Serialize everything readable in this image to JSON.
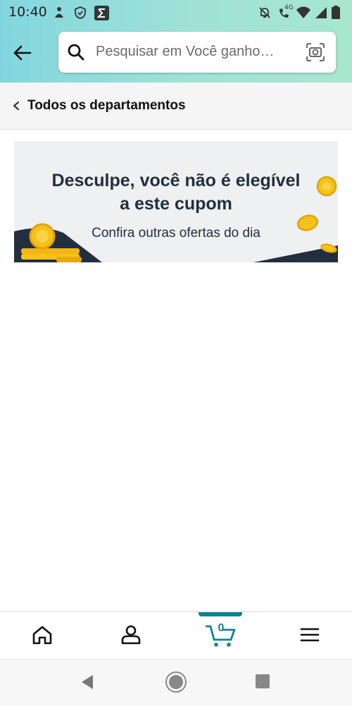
{
  "status_bar": {
    "time": "10:40",
    "left_icons": [
      "person-badge-icon",
      "shield-icon",
      "sigma-app-icon"
    ],
    "right_icons": [
      "notifications-off-icon",
      "call-4g-icon",
      "wifi-icon",
      "signal-icon",
      "battery-icon"
    ],
    "network_label": "4G"
  },
  "search": {
    "placeholder": "Pesquisar em Você ganho…"
  },
  "departments": {
    "label": "Todos os departamentos"
  },
  "banner": {
    "title_line1": "Desculpe, você não é elegível",
    "title_line2": "a este cupom",
    "subtitle": "Confira outras ofertas do dia"
  },
  "bottom_nav": {
    "items": [
      "home-icon",
      "account-icon",
      "cart-icon",
      "menu-icon"
    ],
    "cart_count": "0",
    "accent": "#128291"
  },
  "colors": {
    "header_gradient_start": "#83d6df",
    "header_gradient_end": "#a8e6cf",
    "banner_text": "#232f3e",
    "coin": "#f6c21a"
  }
}
